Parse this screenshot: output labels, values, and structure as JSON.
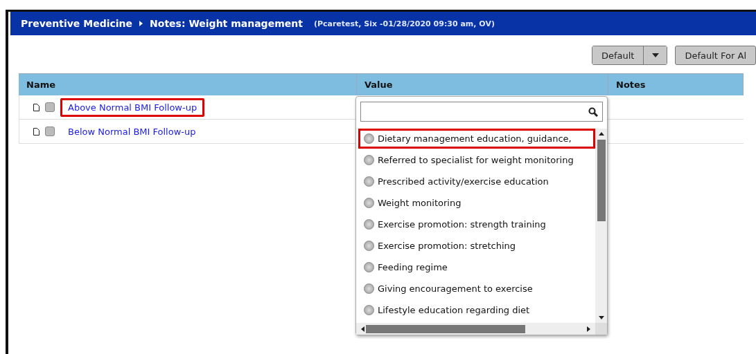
{
  "header": {
    "breadcrumb": [
      "Preventive Medicine",
      "Notes: Weight management"
    ],
    "context": "(Pcaretest, Six -01/28/2020 09:30 am, OV)"
  },
  "toolbar": {
    "split_button": "Default",
    "button": "Default For Al"
  },
  "table": {
    "columns": [
      "Name",
      "Value",
      "Notes"
    ],
    "rows": [
      {
        "name": "Above Normal BMI Follow-up",
        "checked": false,
        "highlighted": true
      },
      {
        "name": "Below Normal BMI Follow-up",
        "checked": false,
        "highlighted": false
      }
    ]
  },
  "dropdown": {
    "options": [
      {
        "label": "Dietary management education, guidance,",
        "selected": false,
        "highlighted": true
      },
      {
        "label": "Referred to specialist for weight monitoring",
        "selected": false,
        "highlighted": false
      },
      {
        "label": "Prescribed activity/exercise education",
        "selected": false,
        "highlighted": false
      },
      {
        "label": "Weight monitoring",
        "selected": false,
        "highlighted": false
      },
      {
        "label": "Exercise promotion: strength training",
        "selected": false,
        "highlighted": false
      },
      {
        "label": "Exercise promotion: stretching",
        "selected": false,
        "highlighted": false
      },
      {
        "label": "Feeding regime",
        "selected": false,
        "highlighted": false
      },
      {
        "label": "Giving encouragement to exercise",
        "selected": false,
        "highlighted": false
      },
      {
        "label": "Lifestyle education regarding diet",
        "selected": false,
        "highlighted": false
      }
    ]
  }
}
